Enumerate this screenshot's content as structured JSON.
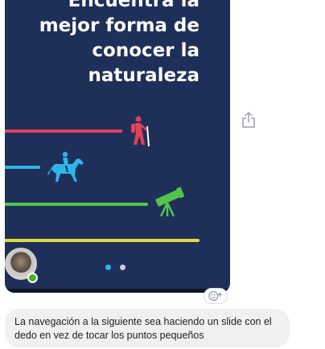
{
  "attachment": {
    "headline": "Encuentra la\nmejor forma de\nconocer la\nnaturaleza",
    "colors": {
      "background": "#1e3059",
      "trail_red": "#e4405a",
      "trail_blue": "#2fb4e8",
      "trail_green": "#54c34e",
      "trail_yellow": "#e1dc3c"
    },
    "icons": [
      "hiker-icon",
      "horse-rider-icon",
      "telescope-icon"
    ],
    "pagination": {
      "total": 2,
      "active": 1
    }
  },
  "sender": {
    "online": true,
    "presence_color": "#42b72a"
  },
  "actions": {
    "share": "share-icon",
    "react": "add-reaction-icon"
  },
  "message": {
    "text": "La navegación a la siguiente sea haciendo un slide con el dedo en vez de tocar los puntos pequeños"
  }
}
